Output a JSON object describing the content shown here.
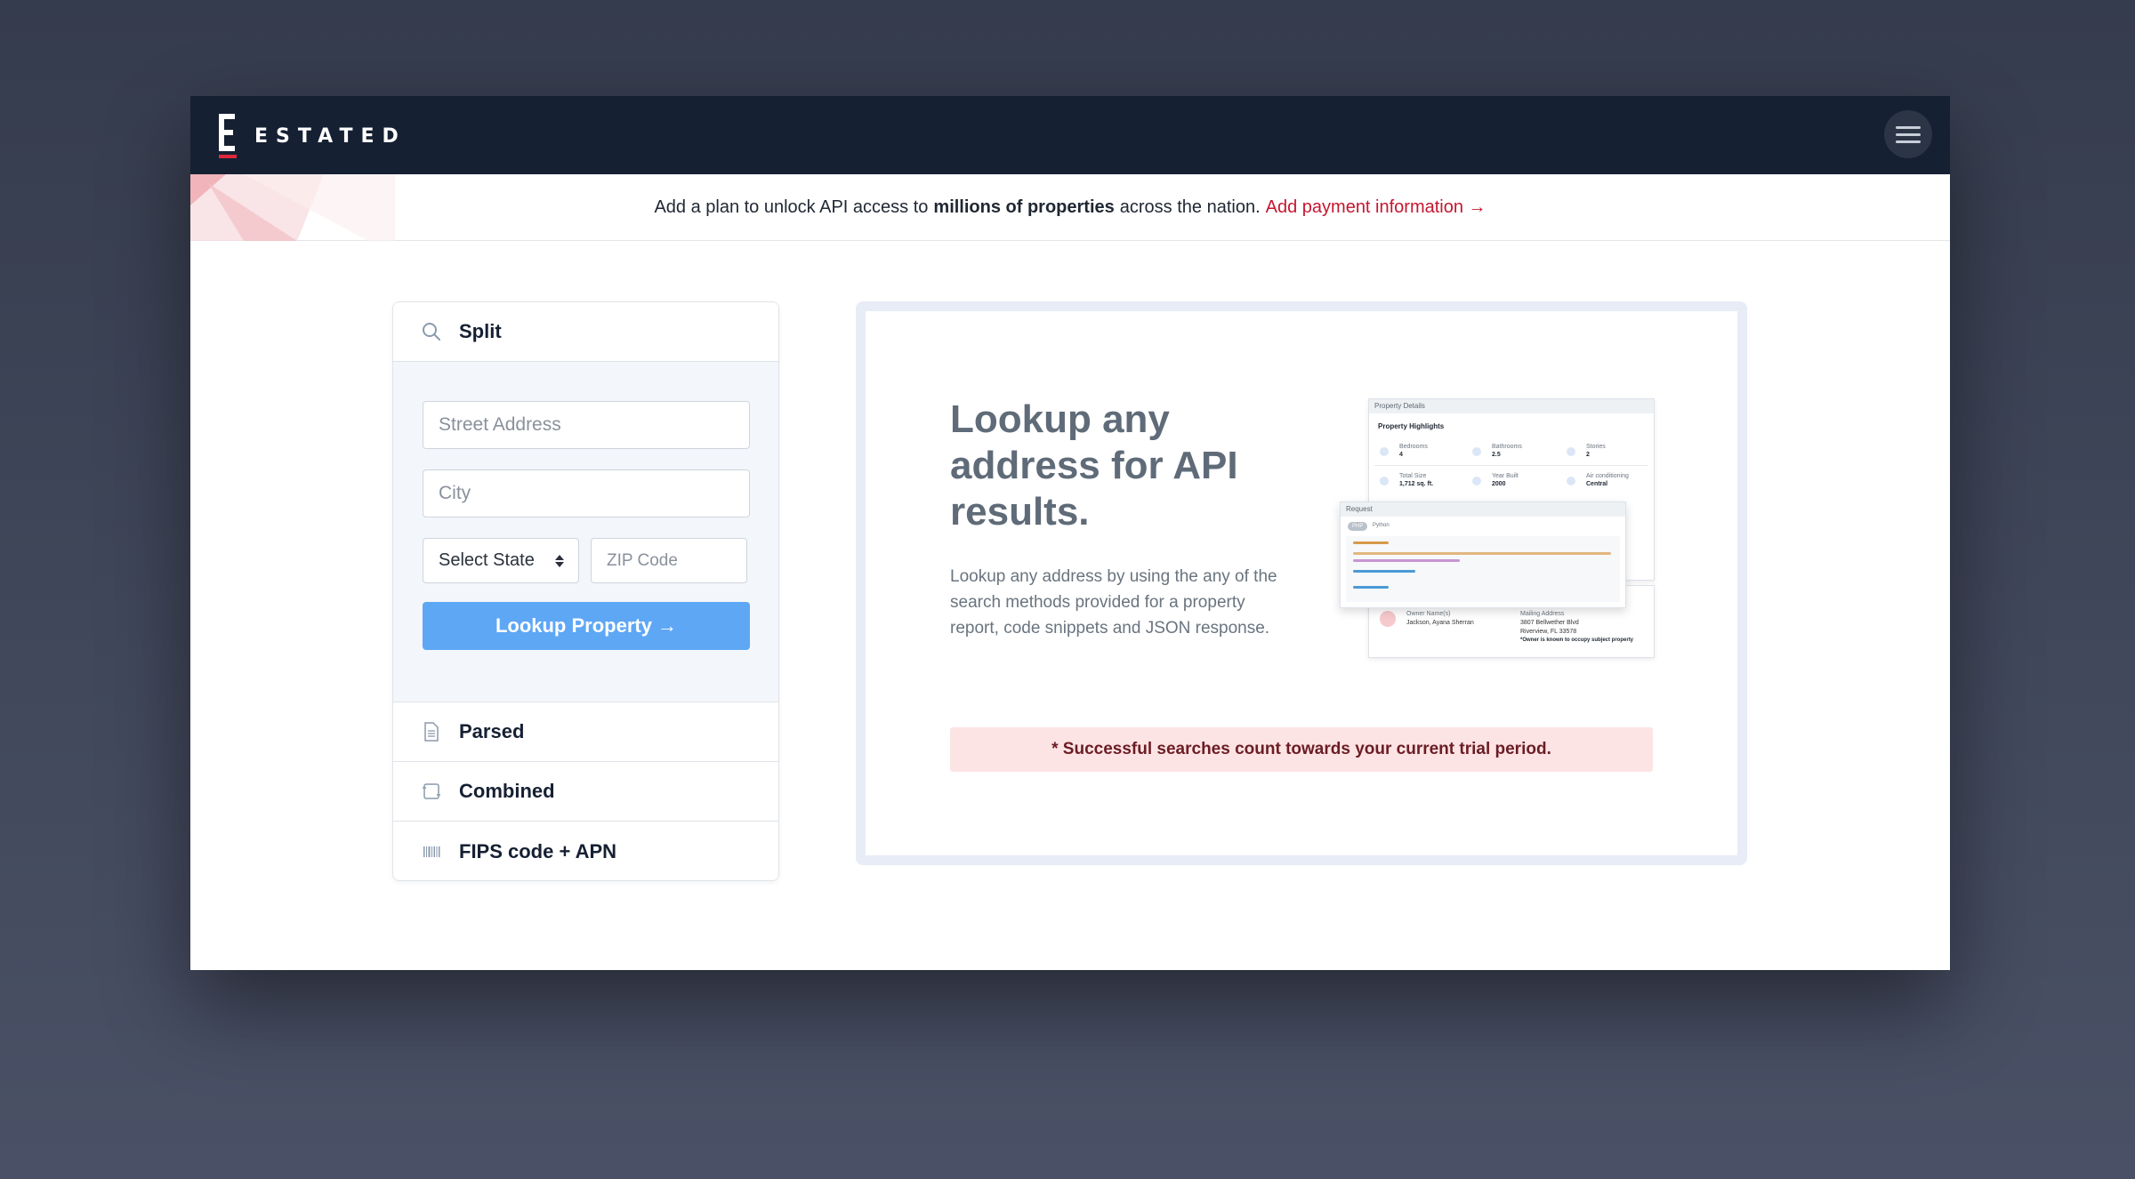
{
  "app": {
    "brand": "ESTATED",
    "menu_icon": "hamburger-icon"
  },
  "banner": {
    "prefix": "Add a plan to unlock API access to",
    "bold": "millions of properties",
    "suffix": "across the nation.",
    "link": "Add payment information →"
  },
  "search": {
    "tabs": [
      {
        "label": "Split",
        "icon": "search-icon",
        "active": true
      },
      {
        "label": "Parsed",
        "icon": "document-icon"
      },
      {
        "label": "Combined",
        "icon": "combined-icon"
      },
      {
        "label": "FIPS code + APN",
        "icon": "barcode-icon"
      }
    ],
    "street_placeholder": "Street Address",
    "city_placeholder": "City",
    "state_selected": "Select State",
    "zip_placeholder": "ZIP Code",
    "lookup_label": "Lookup Property →"
  },
  "info": {
    "title": "Lookup any address for API results.",
    "description": "Lookup any address by using the any of the search methods provided for a property report, code snippets and JSON response.",
    "notice": "* Successful searches count towards your current trial period."
  },
  "preview": {
    "details_title": "Property Details",
    "highlights_title": "Property Highlights",
    "stats": [
      {
        "label": "Bedrooms",
        "value": "4"
      },
      {
        "label": "Bathrooms",
        "value": "2.5"
      },
      {
        "label": "Stories",
        "value": "2"
      },
      {
        "label": "Total Size",
        "value": "1,712 sq. ft."
      },
      {
        "label": "Year Built",
        "value": "2000"
      },
      {
        "label": "Air conditioning",
        "value": "Central"
      }
    ],
    "request_title": "Request",
    "code_tabs": [
      "PHP",
      "Python"
    ],
    "owner_label": "Owner Name(s)",
    "owner_value": "Jackson, Ayana Sherran",
    "mailing_label": "Mailing Address",
    "mailing_line1": "3807 Bellwether Blvd",
    "mailing_line2": "Riverview, FL 33578",
    "mailing_note": "*Owner is known to occupy subject property"
  },
  "colors": {
    "topbar": "#162033",
    "accent_red": "#c5162f",
    "button_blue": "#5ea7f5",
    "notice_bg": "#fde4e4"
  }
}
